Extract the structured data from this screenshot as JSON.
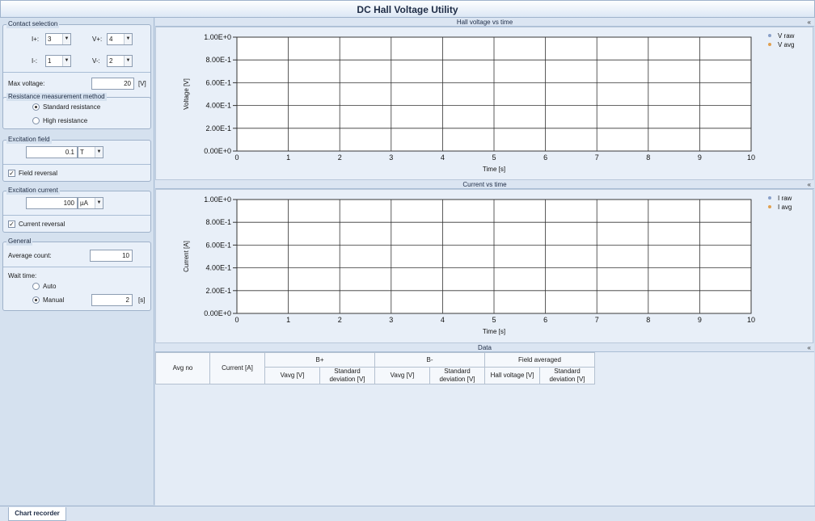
{
  "app": {
    "title": "DC Hall Voltage Utility"
  },
  "contact_selection": {
    "title": "Contact selection",
    "i_plus": {
      "label": "I+:",
      "value": "3"
    },
    "v_plus": {
      "label": "V+:",
      "value": "4"
    },
    "i_minus": {
      "label": "I-:",
      "value": "1"
    },
    "v_minus": {
      "label": "V-:",
      "value": "2"
    },
    "max_voltage": {
      "label": "Max voltage:",
      "value": "20",
      "unit": "[V]"
    }
  },
  "resistance_method": {
    "title": "Resistance measurement method",
    "options": [
      {
        "label": "Standard resistance",
        "selected": true
      },
      {
        "label": "High resistance",
        "selected": false
      }
    ]
  },
  "excitation_field": {
    "title": "Excitation field",
    "value": "0.1",
    "unit": "T",
    "reversal_label": "Field reversal",
    "reversal_checked": true,
    "check_mark": "✓"
  },
  "excitation_current": {
    "title": "Excitation current",
    "value": "100",
    "unit": "µA",
    "reversal_label": "Current reversal",
    "reversal_checked": true,
    "check_mark": "✓"
  },
  "general": {
    "title": "General",
    "average_count_label": "Average count:",
    "average_count": "10",
    "wait_time_label": "Wait time:",
    "wait_options": [
      {
        "label": "Auto",
        "selected": false
      },
      {
        "label": "Manual",
        "selected": true
      }
    ],
    "wait_value": "2",
    "wait_unit": "[s]"
  },
  "collapse_glyph": "«",
  "dropdown_glyph": "▼",
  "chart_data": [
    {
      "type": "scatter",
      "title": "Hall voltage vs time",
      "xlabel": "Time [s]",
      "ylabel": "Voltage [V]",
      "xlim": [
        0,
        10
      ],
      "ylim": [
        0,
        1
      ],
      "x_ticks": [
        "0",
        "1",
        "2",
        "3",
        "4",
        "5",
        "6",
        "7",
        "8",
        "9",
        "10"
      ],
      "y_ticks": [
        "0.00E+0",
        "2.00E-1",
        "4.00E-1",
        "6.00E-1",
        "8.00E-1",
        "1.00E+0"
      ],
      "grid": true,
      "legend_position": "top-right",
      "series": [
        {
          "name": "V raw",
          "color": "#8aa0c8",
          "values": []
        },
        {
          "name": "V avg",
          "color": "#e0a050",
          "values": []
        }
      ]
    },
    {
      "type": "scatter",
      "title": "Current vs time",
      "xlabel": "Time [s]",
      "ylabel": "Current [A]",
      "xlim": [
        0,
        10
      ],
      "ylim": [
        0,
        1
      ],
      "x_ticks": [
        "0",
        "1",
        "2",
        "3",
        "4",
        "5",
        "6",
        "7",
        "8",
        "9",
        "10"
      ],
      "y_ticks": [
        "0.00E+0",
        "2.00E-1",
        "4.00E-1",
        "6.00E-1",
        "8.00E-1",
        "1.00E+0"
      ],
      "grid": true,
      "legend_position": "top-right",
      "series": [
        {
          "name": "I raw",
          "color": "#8aa0c8",
          "values": []
        },
        {
          "name": "I avg",
          "color": "#e0a050",
          "values": []
        }
      ]
    }
  ],
  "data_panel": {
    "title": "Data",
    "groups": {
      "b_plus": "B+",
      "b_minus": "B-",
      "field_averaged": "Field averaged"
    },
    "columns": {
      "avg_no": "Avg no",
      "current": "Current [A]",
      "b_plus_vavg": "Vavg [V]",
      "b_plus_std": "Standard deviation [V]",
      "b_minus_vavg": "Vavg [V]",
      "b_minus_std": "Standard deviation [V]",
      "hall_voltage": "Hall voltage [V]",
      "fa_std": "Standard deviation [V]"
    }
  },
  "tabs": [
    {
      "label": "Chart recorder"
    }
  ]
}
